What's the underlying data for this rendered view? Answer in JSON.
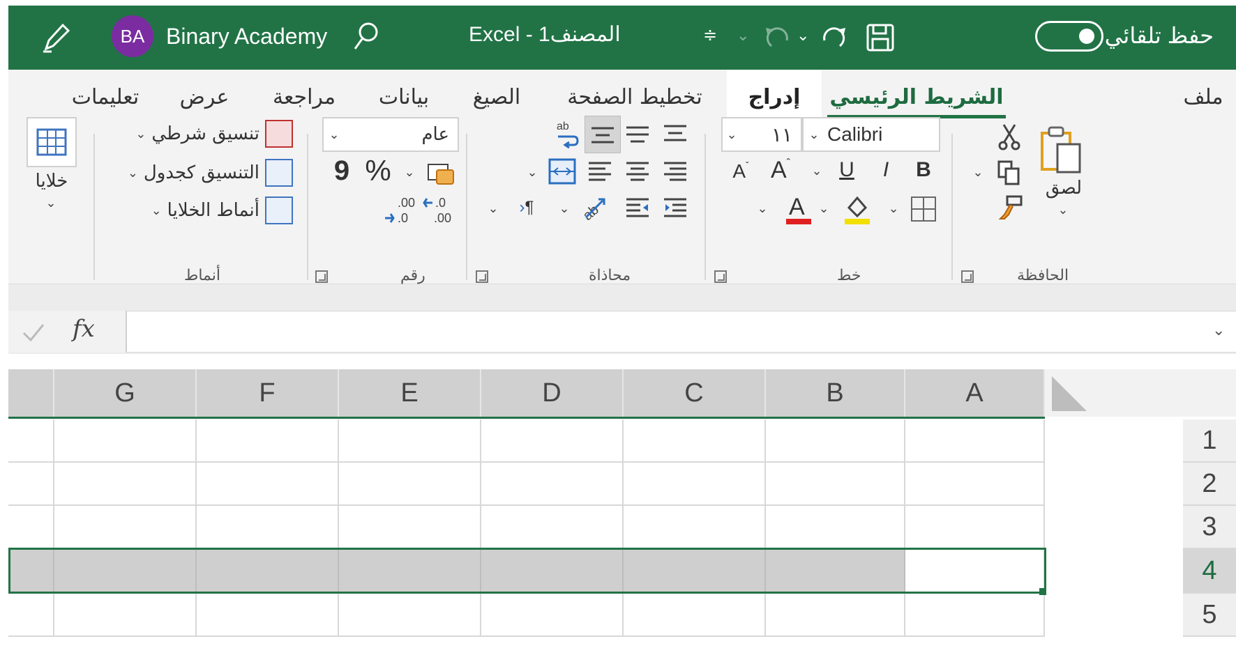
{
  "titlebar": {
    "autosave_label": "حفظ تلقائي",
    "autosave_on": true,
    "file_title": "Excel  -  المصنف1",
    "user_initials": "BA",
    "user_name": "Binary Academy"
  },
  "tabs": [
    "ملف",
    "الشريط الرئيسي",
    "إدراج",
    "تخطيط الصفحة",
    "الصيغ",
    "بيانات",
    "مراجعة",
    "عرض",
    "تعليمات"
  ],
  "active_tab": "الشريط الرئيسي",
  "ribbon": {
    "clipboard": {
      "label": "الحافظة",
      "paste": "لصق"
    },
    "font": {
      "label": "خط",
      "font_name": "Calibri",
      "font_size": "١١",
      "bold": "B",
      "italic": "I",
      "underline": "U"
    },
    "alignment": {
      "label": "محاذاة"
    },
    "number": {
      "label": "رقم",
      "format": "عام",
      "percent": "%",
      "comma": "9"
    },
    "styles": {
      "label": "أنماط",
      "conditional": "تنسيق شرطي",
      "as_table": "التنسيق كجدول",
      "cell_styles": "أنماط الخلايا"
    },
    "cells": {
      "label": "خلايا"
    }
  },
  "formula_bar": {
    "fx": "fx",
    "value": ""
  },
  "grid": {
    "columns": [
      "A",
      "B",
      "C",
      "D",
      "E",
      "F",
      "G"
    ],
    "rows": [
      "1",
      "2",
      "3",
      "4",
      "5"
    ],
    "selected_row": "4",
    "active_cell": "A4"
  },
  "colors": {
    "title_green": "#217346",
    "avatar_purple": "#7b2ca0",
    "selection_gray": "#cfcfcf"
  }
}
